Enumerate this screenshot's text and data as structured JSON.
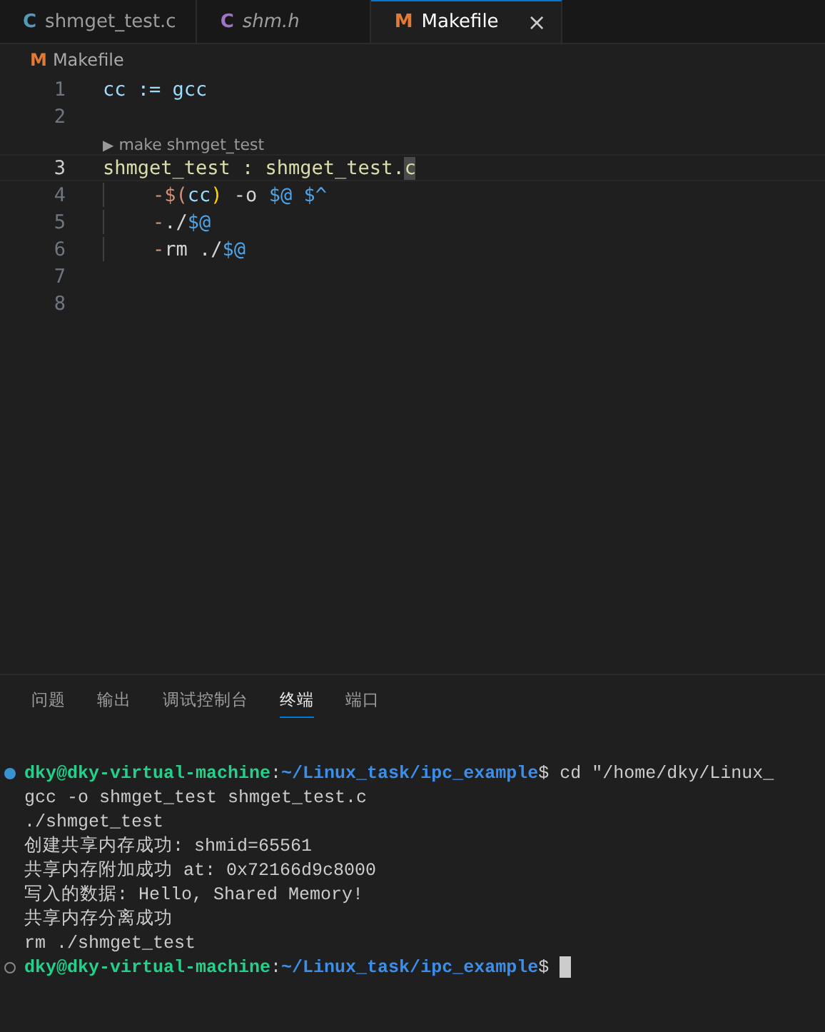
{
  "tabs": [
    {
      "icon": "C",
      "color": "#519aba",
      "label": "shmget_test.c",
      "preview": false,
      "selected": false
    },
    {
      "icon": "C",
      "color": "#a074c4",
      "label": "shm.h",
      "preview": true,
      "selected": false
    },
    {
      "icon": "M",
      "color": "#e37933",
      "label": "Makefile",
      "preview": false,
      "selected": true,
      "close": "×"
    }
  ],
  "breadcrumb": {
    "icon": "M",
    "label": "Makefile"
  },
  "code_lines": [
    {
      "number": "1",
      "active": false,
      "indented": false,
      "tokens": [
        {
          "text": "cc := gcc",
          "kind": "var"
        }
      ]
    },
    {
      "number": "2",
      "active": false,
      "indented": false
    },
    {
      "number": "3",
      "active": true,
      "indented": false,
      "codelens": {
        "glyph": "▶",
        "label": "make shmget_test"
      },
      "tokens": [
        {
          "text": "shmget_test : shmget_test.",
          "kind": "target"
        },
        {
          "text": "c",
          "kind": "cursor"
        }
      ]
    },
    {
      "number": "4",
      "active": false,
      "indented": true,
      "tokens": [
        {
          "text": "-$(",
          "kind": "dash"
        },
        {
          "text": "cc",
          "kind": "var"
        },
        {
          "text": ")",
          "kind": "paren"
        },
        {
          "text": " -o ",
          "kind": "plain"
        },
        {
          "text": "$@ $^",
          "kind": "auto"
        }
      ]
    },
    {
      "number": "5",
      "active": false,
      "indented": true,
      "tokens": [
        {
          "text": "-",
          "kind": "dash"
        },
        {
          "text": "./",
          "kind": "plain"
        },
        {
          "text": "$@",
          "kind": "auto"
        }
      ]
    },
    {
      "number": "6",
      "active": false,
      "indented": true,
      "tokens": [
        {
          "text": "-",
          "kind": "dash"
        },
        {
          "text": "rm ./",
          "kind": "plain"
        },
        {
          "text": "$@",
          "kind": "auto"
        }
      ]
    },
    {
      "number": "7",
      "active": false,
      "indented": false
    },
    {
      "number": "8",
      "active": false,
      "indented": false
    }
  ],
  "panel_tabs": [
    {
      "label": "问题",
      "selected": false
    },
    {
      "label": "输出",
      "selected": false
    },
    {
      "label": "调试控制台",
      "selected": false
    },
    {
      "label": "终端",
      "selected": true
    },
    {
      "label": "端口",
      "selected": false
    }
  ],
  "terminal": [
    {
      "kind": "prompt",
      "finished": true,
      "user": "dky@dky-virtual-machine",
      "sep": ":",
      "path": "~/Linux_task/ipc_example",
      "dollar": "$",
      "command": " cd \"/home/dky/Linux_"
    },
    {
      "kind": "output",
      "text": "gcc -o shmget_test shmget_test.c"
    },
    {
      "kind": "output",
      "text": "./shmget_test"
    },
    {
      "kind": "output",
      "text": "创建共享内存成功: shmid=65561"
    },
    {
      "kind": "output",
      "text": "共享内存附加成功 at: 0x72166d9c8000"
    },
    {
      "kind": "output",
      "text": "写入的数据: Hello, Shared Memory!"
    },
    {
      "kind": "output",
      "text": "共享内存分离成功"
    },
    {
      "kind": "output",
      "text": "rm ./shmget_test"
    },
    {
      "kind": "prompt",
      "finished": false,
      "user": "dky@dky-virtual-machine",
      "sep": ":",
      "path": "~/Linux_task/ipc_example",
      "dollar": "$",
      "cursor": true
    }
  ]
}
